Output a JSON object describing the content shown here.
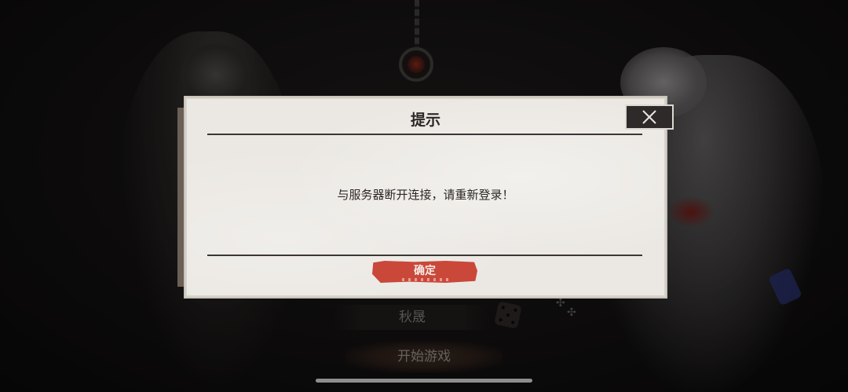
{
  "background": {
    "character_name": "秋晟",
    "start_button_label": "开始游戏"
  },
  "dialog": {
    "title": "提示",
    "message": "与服务器断开连接，请重新登录！",
    "confirm_label": "确定",
    "close_icon": "close-icon"
  },
  "colors": {
    "dialog_bg": "#ebe8e3",
    "confirm_button": "#c9483a",
    "close_button_bg": "#2e2a2a",
    "text": "#2b2727"
  }
}
